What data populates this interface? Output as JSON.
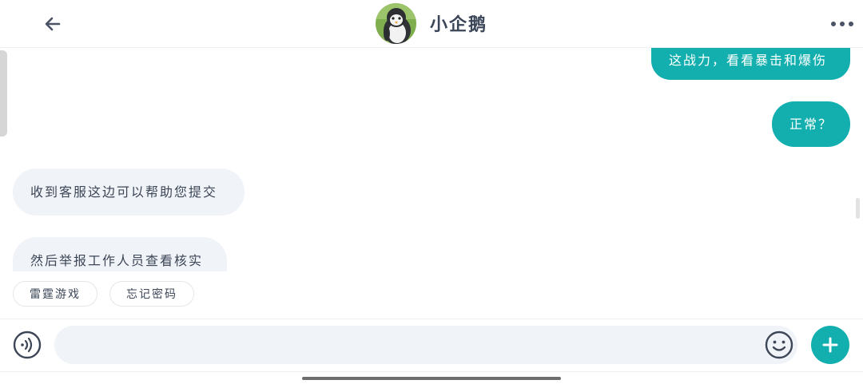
{
  "header": {
    "title": "小企鹅",
    "back_icon": "arrow-left-icon",
    "more_icon": "more-dots-icon",
    "avatar": "penguin-avatar"
  },
  "messages": [
    {
      "direction": "out",
      "text": "这战力，看看暴击和爆伤"
    },
    {
      "direction": "out",
      "text": "正常？"
    },
    {
      "direction": "in",
      "text": "收到客服这边可以帮助您提交"
    },
    {
      "direction": "in",
      "text": "然后举报工作人员查看核实"
    }
  ],
  "quick_replies": [
    "雷霆游戏",
    "忘记密码"
  ],
  "composer": {
    "placeholder": "",
    "voice_icon": "voice-icon",
    "emoji_icon": "emoji-icon",
    "plus_icon": "plus-icon"
  },
  "colors": {
    "accent": "#13afaf",
    "incoming_bubble": "#f0f3f7",
    "text": "#3c4657"
  }
}
